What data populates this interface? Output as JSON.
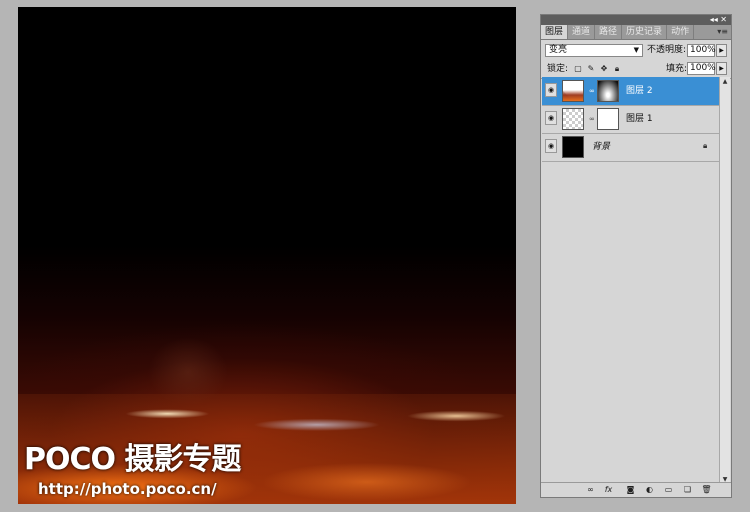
{
  "canvas": {
    "watermark_logo": "POCO 摄影专题",
    "watermark_url": "http://photo.poco.cn/"
  },
  "panel": {
    "tabs": [
      "图层",
      "通道",
      "路径",
      "历史记录",
      "动作"
    ],
    "blend_mode": "变亮",
    "opacity_label": "不透明度:",
    "opacity_value": "100%",
    "lock_label": "锁定:",
    "fill_label": "填充:",
    "fill_value": "100%",
    "layers": [
      {
        "name": "图层 2",
        "selected": true
      },
      {
        "name": "图层 1",
        "selected": false
      },
      {
        "name": "背景",
        "selected": false
      }
    ]
  },
  "colors": {
    "selection": "#3a8fd4",
    "panel_bg": "#d6d6d6",
    "app_bg": "#b5b5b5"
  }
}
